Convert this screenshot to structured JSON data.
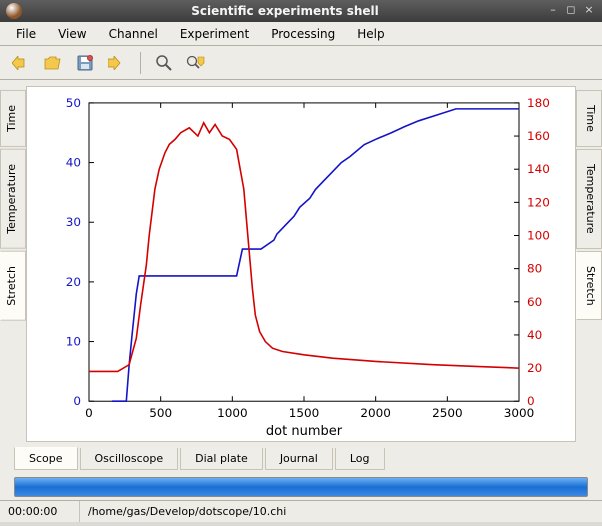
{
  "window": {
    "title": "Scientific experiments shell"
  },
  "menu": {
    "file": "File",
    "view": "View",
    "channel": "Channel",
    "experiment": "Experiment",
    "processing": "Processing",
    "help": "Help"
  },
  "side_tabs_left": [
    "Time",
    "Temperature",
    "Stretch"
  ],
  "side_tabs_right": [
    "Time",
    "Temperature",
    "Stretch"
  ],
  "side_active_left": 2,
  "side_active_right": 2,
  "bottom_tabs": [
    "Scope",
    "Oscilloscope",
    "Dial plate",
    "Journal",
    "Log"
  ],
  "bottom_active": 0,
  "status": {
    "time": "00:00:00",
    "path": "/home/gas/Develop/dotscope/10.chi"
  },
  "chart_data": {
    "type": "line",
    "xlabel": "dot number",
    "xlim": [
      0,
      3000
    ],
    "xticks": [
      0,
      500,
      1000,
      1500,
      2000,
      2500,
      3000
    ],
    "left_axis": {
      "ylim": [
        0,
        50
      ],
      "yticks": [
        0,
        10,
        20,
        30,
        40,
        50
      ],
      "color": "#1414c8"
    },
    "right_axis": {
      "ylim": [
        0,
        180
      ],
      "yticks": [
        0,
        20,
        40,
        60,
        80,
        100,
        120,
        140,
        160,
        180
      ],
      "color": "#d40000"
    },
    "series": [
      {
        "name": "blue",
        "axis": "left",
        "color": "#1414c8",
        "points": [
          [
            0,
            null
          ],
          [
            160,
            0
          ],
          [
            260,
            0
          ],
          [
            280,
            6
          ],
          [
            300,
            11
          ],
          [
            330,
            18
          ],
          [
            350,
            21
          ],
          [
            400,
            21
          ],
          [
            700,
            21
          ],
          [
            1000,
            21
          ],
          [
            1030,
            21
          ],
          [
            1070,
            25.5
          ],
          [
            1200,
            25.5
          ],
          [
            1290,
            27
          ],
          [
            1310,
            28
          ],
          [
            1370,
            29.5
          ],
          [
            1430,
            31
          ],
          [
            1470,
            32.5
          ],
          [
            1540,
            34
          ],
          [
            1580,
            35.5
          ],
          [
            1640,
            37
          ],
          [
            1700,
            38.5
          ],
          [
            1760,
            40
          ],
          [
            1820,
            41
          ],
          [
            1920,
            43
          ],
          [
            2010,
            44
          ],
          [
            2110,
            45
          ],
          [
            2200,
            46
          ],
          [
            2300,
            47
          ],
          [
            2430,
            48
          ],
          [
            2560,
            49
          ],
          [
            2700,
            49
          ],
          [
            2900,
            49
          ],
          [
            3000,
            49
          ]
        ]
      },
      {
        "name": "red",
        "axis": "right",
        "color": "#d40000",
        "points": [
          [
            0,
            18
          ],
          [
            100,
            18
          ],
          [
            200,
            18
          ],
          [
            280,
            22
          ],
          [
            330,
            38
          ],
          [
            360,
            58
          ],
          [
            400,
            82
          ],
          [
            420,
            100
          ],
          [
            460,
            128
          ],
          [
            490,
            140
          ],
          [
            530,
            150
          ],
          [
            560,
            155
          ],
          [
            600,
            158
          ],
          [
            640,
            162
          ],
          [
            700,
            165
          ],
          [
            760,
            160
          ],
          [
            800,
            168
          ],
          [
            840,
            162
          ],
          [
            880,
            167
          ],
          [
            930,
            160
          ],
          [
            980,
            158
          ],
          [
            1030,
            152
          ],
          [
            1080,
            128
          ],
          [
            1110,
            98
          ],
          [
            1140,
            68
          ],
          [
            1160,
            52
          ],
          [
            1190,
            42
          ],
          [
            1230,
            36
          ],
          [
            1280,
            32
          ],
          [
            1350,
            30
          ],
          [
            1500,
            28
          ],
          [
            1700,
            26
          ],
          [
            2000,
            24
          ],
          [
            2400,
            22
          ],
          [
            2700,
            21
          ],
          [
            3000,
            20
          ]
        ]
      }
    ]
  }
}
